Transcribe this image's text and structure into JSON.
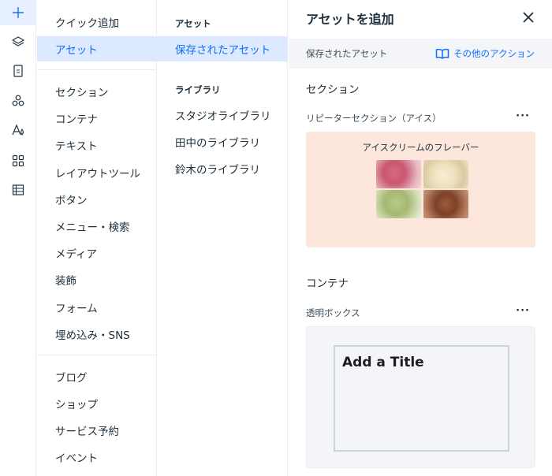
{
  "rail": {
    "items": [
      {
        "icon": "plus-icon",
        "active": true
      },
      {
        "icon": "layers-icon"
      },
      {
        "icon": "page-icon"
      },
      {
        "icon": "components-icon"
      },
      {
        "icon": "typography-icon"
      },
      {
        "icon": "apps-grid-icon"
      },
      {
        "icon": "table-icon"
      }
    ]
  },
  "categories": {
    "group1": [
      "クイック追加",
      "アセット"
    ],
    "group2": [
      "セクション",
      "コンテナ",
      "テキスト",
      "レイアウトツール",
      "ボタン",
      "メニュー・検索",
      "メディア",
      "装飾",
      "フォーム",
      "埋め込み・SNS"
    ],
    "group3": [
      "ブログ",
      "ショップ",
      "サービス予約",
      "イベント"
    ],
    "active": "アセット"
  },
  "assets": {
    "heading": "アセット",
    "saved": "保存されたアセット",
    "library_heading": "ライブラリ",
    "libraries": [
      "スタジオライブラリ",
      "田中のライブラリ",
      "鈴木のライブラリ"
    ]
  },
  "panel": {
    "title": "アセットを追加",
    "subbar_label": "保存されたアセット",
    "more_actions": "その他のアクション",
    "sections": [
      {
        "title": "セクション",
        "item_label": "リピーターセクション（アイス）",
        "card_title": "アイスクリームのフレーバー"
      },
      {
        "title": "コンテナ",
        "item_label": "透明ボックス",
        "card_title": "Add a Title"
      }
    ]
  },
  "colors": {
    "accent": "#116dff",
    "active_bg": "#dce9ff",
    "card_peach": "#fde7dd",
    "card_gray": "#f4f5f8"
  }
}
